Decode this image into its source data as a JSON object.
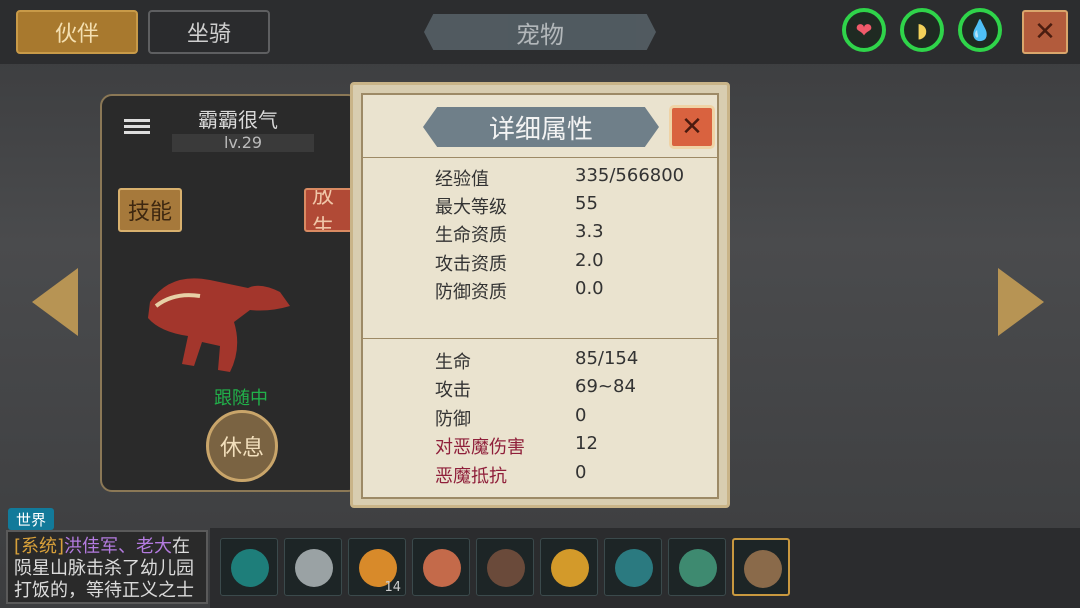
{
  "top_tabs": {
    "companion": "伙伴",
    "mount": "坐骑"
  },
  "page_title": "宠物",
  "status_rings": [
    {
      "icon": "heart-icon",
      "glyph": "❤",
      "color": "#f05a6a"
    },
    {
      "icon": "banana-icon",
      "glyph": "◗",
      "color": "#f2d25a"
    },
    {
      "icon": "water-drop-icon",
      "glyph": "💧",
      "color": "#33c7e6"
    }
  ],
  "close_glyph": "✕",
  "pet": {
    "name": "霸霸很气",
    "level": "lv.29",
    "skill_label": "技能",
    "release_label": "放生",
    "status": "跟随中",
    "rest_label": "休息"
  },
  "detail": {
    "title": "详细属性",
    "close_glyph": "✕",
    "section1": [
      {
        "key": "经验值",
        "value": "335/566800"
      },
      {
        "key": "最大等级",
        "value": "55"
      },
      {
        "key": "生命资质",
        "value": "3.3"
      },
      {
        "key": "攻击资质",
        "value": "2.0"
      },
      {
        "key": "防御资质",
        "value": "0.0"
      }
    ],
    "section2": [
      {
        "key": "生命",
        "value": "85/154",
        "highlight": false
      },
      {
        "key": "攻击",
        "value": "69~84",
        "highlight": false
      },
      {
        "key": "防御",
        "value": "0",
        "highlight": false
      },
      {
        "key": "对恶魔伤害",
        "value": "12",
        "highlight": true
      },
      {
        "key": "恶魔抵抗",
        "value": "0",
        "highlight": true
      }
    ]
  },
  "chat": {
    "channel": "世界",
    "prefix": "[系统]",
    "players": "洪佳军、老大",
    "message": "在陨星山脉击杀了幼儿园打饭的，等待正义之士"
  },
  "hotbar": [
    {
      "name": "portal-item",
      "color": "#1e7e7a",
      "count": ""
    },
    {
      "name": "disc-item",
      "color": "#9aa2a4",
      "count": ""
    },
    {
      "name": "fries-item",
      "color": "#d88a2a",
      "count": "14"
    },
    {
      "name": "meat-item",
      "color": "#c46a4a",
      "count": ""
    },
    {
      "name": "pickaxe-item",
      "color": "#6a4a3a",
      "count": ""
    },
    {
      "name": "banana-item",
      "color": "#d39a2a",
      "count": ""
    },
    {
      "name": "crystal-pickaxe-item",
      "color": "#2b7a80",
      "count": ""
    },
    {
      "name": "staff-item",
      "color": "#3e8a70",
      "count": ""
    },
    {
      "name": "spear-item",
      "color": "#8a6a4a",
      "count": "",
      "selected": true
    }
  ]
}
